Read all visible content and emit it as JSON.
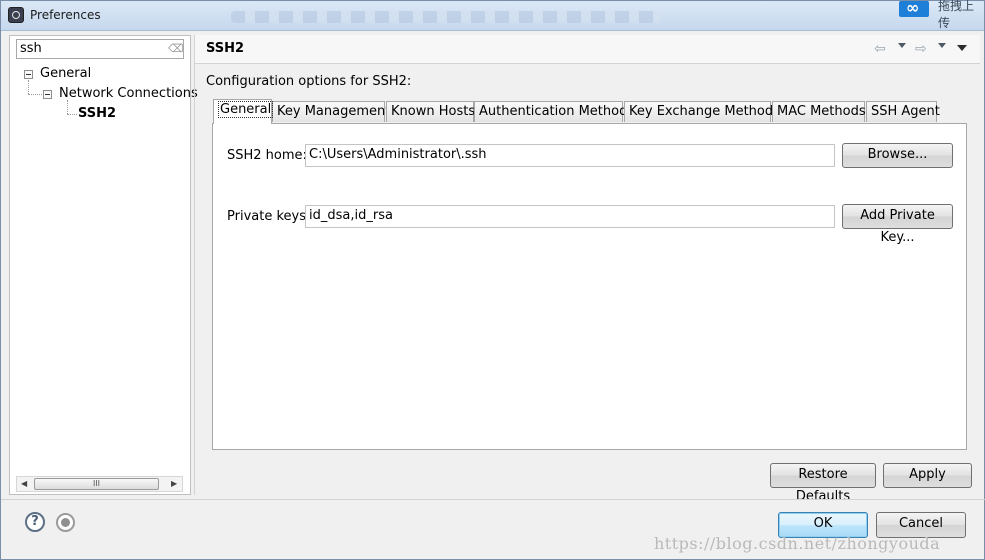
{
  "window": {
    "title": "Preferences",
    "title_extra_text": "拖拽上传"
  },
  "sidebar": {
    "filter_value": "ssh",
    "tree": [
      {
        "label": "General"
      },
      {
        "label": "Network Connections"
      },
      {
        "label": "SSH2"
      }
    ],
    "scroll_thumb_glyph": "III",
    "scroll_left_glyph": "◀",
    "scroll_right_glyph": "▶"
  },
  "page": {
    "title": "SSH2",
    "description": "Configuration options for SSH2:",
    "tabs": [
      {
        "label": "General"
      },
      {
        "label": "Key Management"
      },
      {
        "label": "Known Hosts"
      },
      {
        "label": "Authentication Methods"
      },
      {
        "label": "Key Exchange Methods"
      },
      {
        "label": "MAC Methods"
      },
      {
        "label": "SSH Agent"
      }
    ],
    "fields": {
      "ssh2_home_label": "SSH2 home:",
      "ssh2_home_value": "C:\\Users\\Administrator\\.ssh",
      "browse_label": "Browse...",
      "private_keys_label": "Private keys:",
      "private_keys_value": "id_dsa,id_rsa",
      "add_key_label": "Add Private Key..."
    },
    "restore_defaults_label": "Restore Defaults",
    "apply_label": "Apply"
  },
  "footer": {
    "ok_label": "OK",
    "cancel_label": "Cancel",
    "help_glyph": "?",
    "watermark": "https://blog.csdn.net/zhongyouda"
  },
  "icons": {
    "app": "eclipse-icon",
    "nav_back": "back-arrow-icon",
    "nav_forward": "forward-arrow-icon",
    "view_menu": "view-menu-icon",
    "help": "help-icon",
    "record": "record-macro-icon",
    "clear": "clear-filter-icon"
  }
}
